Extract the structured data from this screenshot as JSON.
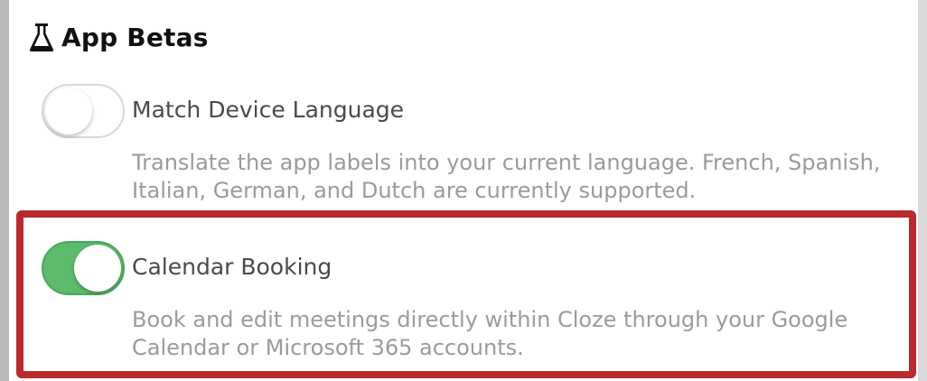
{
  "section": {
    "icon": "flask-icon",
    "title": "App Betas"
  },
  "settings": [
    {
      "label": "Match Device Language",
      "description": "Translate the app labels into your current language. French, Spanish, Italian, German, and Dutch are currently supported.",
      "enabled": false
    },
    {
      "label": "Calendar Booking",
      "description": "Book and edit meetings directly within Cloze through your Google Calendar or Microsoft 365 accounts.",
      "enabled": true
    }
  ],
  "colors": {
    "toggle_on": "#5cba6b",
    "toggle_off_border": "#d8d8d8",
    "highlight": "#b72b2f",
    "label_text": "#4a4a4a",
    "description_text": "#9b9b9b"
  }
}
